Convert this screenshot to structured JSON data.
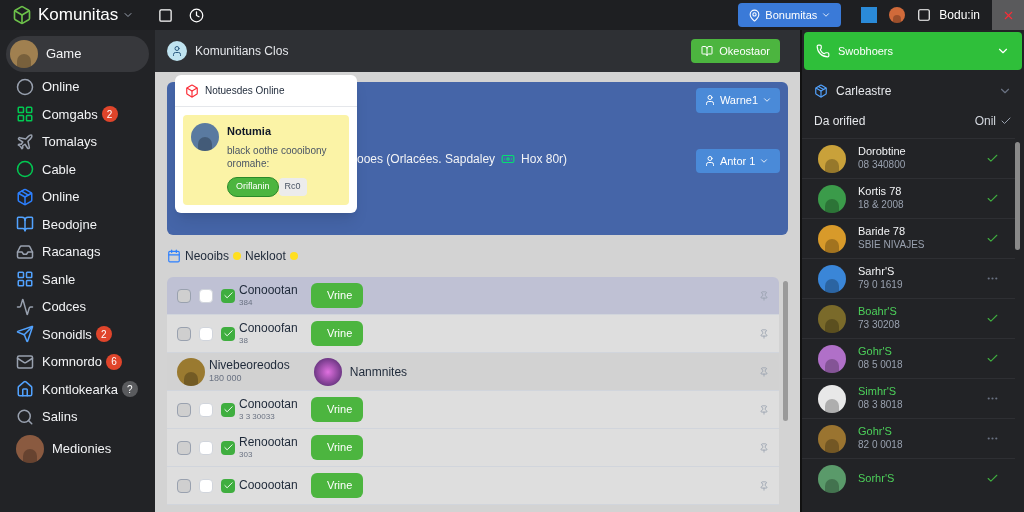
{
  "topbar": {
    "app_title": "Komunitas",
    "location_button": "Bonumitas",
    "user_name": "Bodu:in"
  },
  "sidebar": {
    "items": [
      {
        "label": "Game",
        "kind": "avatar",
        "selected": true
      },
      {
        "label": "Online",
        "kind": "icon",
        "selected": false
      },
      {
        "label": "Comgabs",
        "kind": "icon",
        "selected": false,
        "badge": "2",
        "color": "#e0452b"
      },
      {
        "label": "Tomalays",
        "kind": "icon",
        "selected": false
      },
      {
        "label": "Cable",
        "kind": "icon",
        "selected": false
      },
      {
        "label": "Online",
        "kind": "icon",
        "selected": false
      },
      {
        "label": "Beodojne",
        "kind": "icon",
        "selected": false
      },
      {
        "label": "Racanags",
        "kind": "icon",
        "selected": false
      },
      {
        "label": "Sanle",
        "kind": "icon",
        "selected": false
      },
      {
        "label": "Codces",
        "kind": "icon",
        "selected": false
      },
      {
        "label": "Sonoidls",
        "kind": "icon",
        "selected": false,
        "badge": "2",
        "color": "#e0452b"
      },
      {
        "label": "Komnordo",
        "kind": "icon",
        "selected": false,
        "badge": "6",
        "color": "#e0452b"
      },
      {
        "label": "Kontlokearka",
        "kind": "icon",
        "selected": false,
        "badge": "?",
        "color": "#5a5b5e"
      },
      {
        "label": "Salins",
        "kind": "icon",
        "selected": false
      },
      {
        "label": "Medionies",
        "kind": "avatar",
        "selected": false
      }
    ]
  },
  "main": {
    "title": "Komunitians Clos",
    "action_button": "Okeostaor",
    "card": {
      "text": "ooes (Orlacées. Sapdaley",
      "text_end": "Hox 80r)",
      "buttons": [
        "Warne1",
        "Antor 1"
      ]
    },
    "popup": {
      "title": "Notuesdes Online",
      "note_title": "Notumia",
      "note_text": "black oothe coooibony oromahe:",
      "accept_button": "Oriflanin",
      "other_button": "Rc0"
    },
    "section": {
      "label": "Neooibs",
      "label_2": "Nekloot"
    },
    "rows": [
      {
        "kind": "task",
        "selected": true,
        "checks": [
          false,
          false,
          true
        ],
        "title": "Conoootan",
        "subtitle": "384",
        "button": "Vrine"
      },
      {
        "kind": "task",
        "selected": false,
        "checks": [
          false,
          false,
          true
        ],
        "title": "Conooofan",
        "subtitle": "38",
        "button": "Vrine"
      },
      {
        "kind": "person",
        "selected": false,
        "title": "Nivebeoreodos",
        "subtitle": "180 000",
        "title_2": "Nanmnites"
      },
      {
        "kind": "task",
        "selected": false,
        "checks": [
          false,
          false,
          true
        ],
        "title": "Conoootan",
        "subtitle": "3 3 30033",
        "button": "Vrine"
      },
      {
        "kind": "task",
        "selected": false,
        "checks": [
          false,
          false,
          true
        ],
        "title": "Renoootan",
        "subtitle": "303",
        "button": "Vrine"
      },
      {
        "kind": "task",
        "selected": false,
        "checks": [
          false,
          false,
          true
        ],
        "title": "Coooootan",
        "button": "Vrine"
      }
    ]
  },
  "right_panel": {
    "header": "Swobhoers",
    "section": "Carleastre",
    "filter_label": "Da orified",
    "filter_value": "Onil",
    "contacts": [
      {
        "name": "Dorobtine",
        "detail": "08 340800",
        "online": false,
        "kind": "check"
      },
      {
        "name": "Kortis 78",
        "detail": "18 & 2008",
        "online": false,
        "kind": "check"
      },
      {
        "name": "Baride 78",
        "detail": "SBIE NIVAJES",
        "online": false,
        "kind": "check"
      },
      {
        "name": "Sarhr'S",
        "detail": "79 0 1619",
        "online": false,
        "kind": "more"
      },
      {
        "name": "Boahr'S",
        "detail": "73 30208",
        "online": true,
        "kind": "check"
      },
      {
        "name": "Gohr'S",
        "detail": "08 5 0018",
        "online": true,
        "kind": "check"
      },
      {
        "name": "Simhr'S",
        "detail": "08 3 8018",
        "online": true,
        "kind": "more"
      },
      {
        "name": "Gohr'S",
        "detail": "82 0 0018",
        "online": true,
        "kind": "more"
      },
      {
        "name": "Sorhr'S",
        "online": true,
        "kind": "check"
      }
    ]
  }
}
